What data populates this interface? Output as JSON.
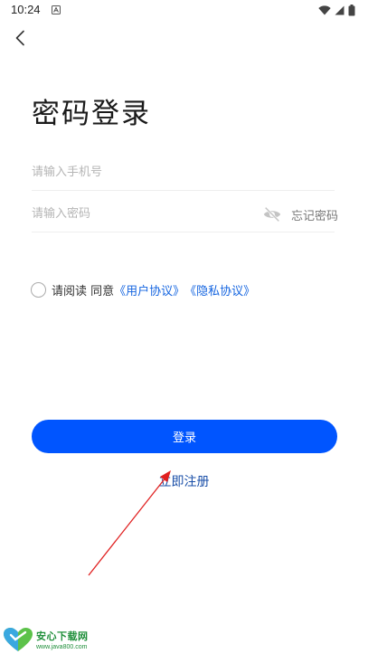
{
  "status_bar": {
    "time": "10:24"
  },
  "header": {
    "back_icon": "chevron-left-icon"
  },
  "title": "密码登录",
  "form": {
    "phone_placeholder": "请输入手机号",
    "phone_value": "",
    "password_placeholder": "请输入密码",
    "password_value": "",
    "visibility_icon": "eye-off-icon",
    "forgot_label": "忘记密码"
  },
  "agreement": {
    "checked": false,
    "prefix": "请阅读 同意",
    "user_agreement": "《用户协议》",
    "privacy_agreement": "《隐私协议》"
  },
  "buttons": {
    "login_label": "登录",
    "register_label": "立即注册"
  },
  "watermark": {
    "title": "安心下载网",
    "url": "www.java800.com"
  },
  "colors": {
    "primary": "#0055ff",
    "link": "#1565e0",
    "annotation_arrow": "#e02020"
  }
}
